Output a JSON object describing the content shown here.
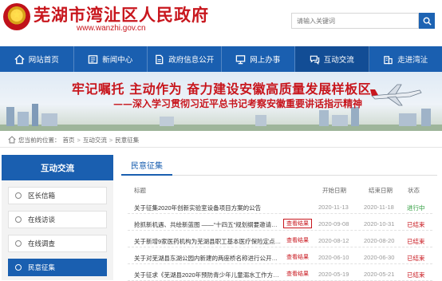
{
  "header": {
    "site_title": "芜湖市湾沚区人民政府",
    "site_url": "www.wanzhi.gov.cn",
    "search_placeholder": "请输入关键词"
  },
  "colors": {
    "brand_blue": "#1a5fb0",
    "brand_red": "#c8161d",
    "ongoing_green": "#2a9b3a"
  },
  "nav": [
    {
      "label": "网站首页",
      "icon": "home-icon"
    },
    {
      "label": "新闻中心",
      "icon": "news-icon"
    },
    {
      "label": "政府信息公开",
      "icon": "document-icon"
    },
    {
      "label": "网上办事",
      "icon": "monitor-icon"
    },
    {
      "label": "互动交流",
      "icon": "chat-icon",
      "active": true
    },
    {
      "label": "走进湾沚",
      "icon": "building-icon"
    }
  ],
  "banner": {
    "line1": "牢记嘱托 主动作为 奋力建设安徽高质量发展样板区",
    "line2": "——深入学习贯彻习近平总书记考察安徽重要讲话指示精神"
  },
  "breadcrumb": {
    "prefix": "您当前的位置：",
    "items": [
      "首页",
      "互动交流",
      "民意征集"
    ],
    "separator": ">"
  },
  "sidebar": {
    "heading": "互动交流",
    "items": [
      {
        "label": "区长信箱",
        "active": false
      },
      {
        "label": "在线访谈",
        "active": false
      },
      {
        "label": "在线调查",
        "active": false
      },
      {
        "label": "民意征集",
        "active": true
      }
    ]
  },
  "main": {
    "tab": "民意征集",
    "columns": {
      "title": "标题",
      "start": "开始日期",
      "end": "结束日期",
      "status": "状态"
    },
    "rows": [
      {
        "title": "关于征集2020年创新实验室设备项目方案的公告",
        "result": "",
        "start": "2020-11-13",
        "end": "2020-11-18",
        "status": "进行中",
        "status_type": "ongoing"
      },
      {
        "title": "抢抓新机遇、共绘新蓝图 ——“十四五”规划纲要邀请建言献策",
        "result": "查看结果",
        "result_boxed": true,
        "start": "2020-09-08",
        "end": "2020-10-31",
        "status": "已结束",
        "status_type": "ended"
      },
      {
        "title": "关于新增9家医药机构为芜湖县职工基本医疗保险定点机构的公示",
        "result": "查看结果",
        "result_boxed": false,
        "start": "2020-08-12",
        "end": "2020-08-20",
        "status": "已结束",
        "status_type": "ended"
      },
      {
        "title": "关于对芜湖县东湖公园内新建的两座桥名称进行公开征求意见",
        "result": "查看结果",
        "result_boxed": false,
        "start": "2020-06-10",
        "end": "2020-06-30",
        "status": "已结束",
        "status_type": "ended"
      },
      {
        "title": "关于征求《芜湖县2020年预防青少年儿童溺水工作方案》意见",
        "result": "查看结果",
        "result_boxed": false,
        "start": "2020-05-19",
        "end": "2020-05-21",
        "status": "已结束",
        "status_type": "ended"
      }
    ]
  }
}
